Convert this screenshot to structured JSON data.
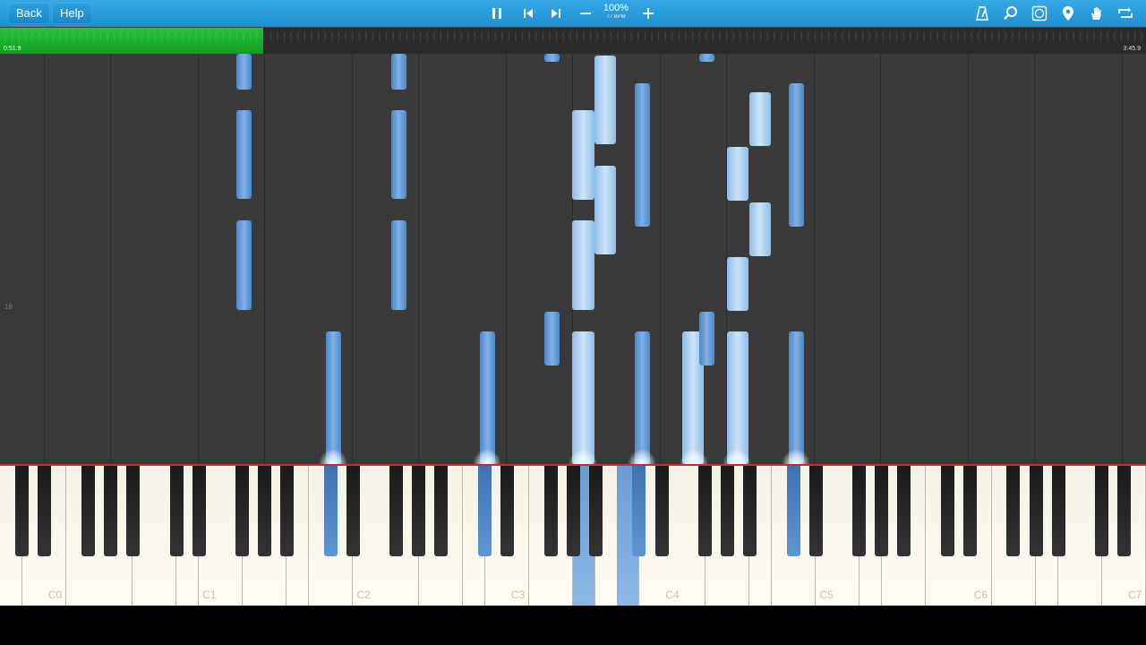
{
  "toolbar": {
    "back_label": "Back",
    "help_label": "Help",
    "zoom_percent": "100%",
    "tempo": "77 BPM",
    "icons": [
      "pause-icon",
      "skip-back-icon",
      "skip-forward-icon",
      "zoom-out-icon",
      "zoom-in-icon",
      "metronome-icon",
      "search-icon",
      "sheet-music-icon",
      "location-icon",
      "hand-icon",
      "loop-icon"
    ]
  },
  "progress": {
    "elapsed": "0:51.9",
    "total": "3:45.9",
    "fraction": 0.23,
    "color": "#1aad2b"
  },
  "roll": {
    "measure_label": "18",
    "note_color": "#5f98d6",
    "highlight_color": "#b9d8f3"
  },
  "keyboard": {
    "octave_labels": [
      "C0",
      "C1",
      "C2",
      "C3",
      "C4",
      "C5",
      "C6",
      "C7"
    ]
  }
}
